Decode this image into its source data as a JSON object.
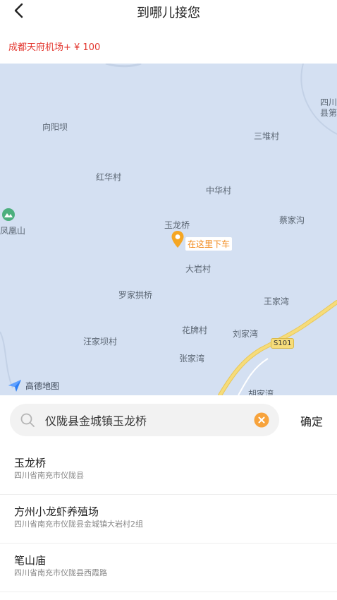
{
  "header": {
    "title": "到哪儿接您",
    "back_icon": "chevron-left-icon"
  },
  "price_line": "成都天府机场+ ¥ 100",
  "map": {
    "places": {
      "xiangyangba": "向阳坝",
      "sanduicun": "三堆村",
      "honghuacun": "红华村",
      "zhonghuacun": "中华村",
      "fenghuangshan": "凤凰山",
      "yulongqiao": "玉龙桥",
      "caijiagou": "蔡家沟",
      "dayancun": "大岩村",
      "luojiagongqiao": "罗家拱桥",
      "wangjiawan": "王家湾",
      "huapaicun": "花牌村",
      "liujiawan": "刘家湾",
      "wangjiabacun": "汪家坝村",
      "zhangjiawan": "张家湾",
      "sichuan_county": "四川\n县第",
      "bottom_cut": "胡家湾"
    },
    "pin_label": "在这里下车",
    "road_badge": "S101",
    "logo_text": "高德地图",
    "colors": {
      "water": "#d4e0f2",
      "road": "#f6dc7a",
      "pin": "#f5a623"
    }
  },
  "search": {
    "value": "仪陇县金城镇玉龙桥",
    "confirm_label": "确定",
    "search_icon": "search-icon",
    "clear_icon": "clear-icon"
  },
  "results": [
    {
      "name": "玉龙桥",
      "address": "四川省南充市仪陇县"
    },
    {
      "name": "方州小龙虾养殖场",
      "address": "四川省南充市仪陇县金城镇大岩村2组"
    },
    {
      "name": "笔山庙",
      "address": "四川省南充市仪陇县西霞路"
    }
  ]
}
